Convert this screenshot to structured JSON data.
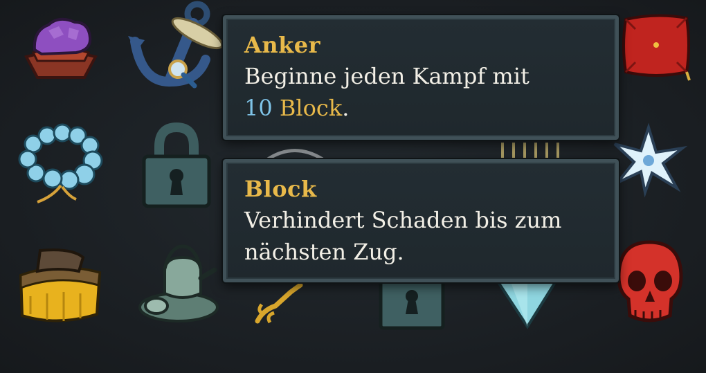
{
  "relics": [
    {
      "name": "Pandora-Box",
      "icon": "purple-crystal-on-pedestal-icon"
    },
    {
      "name": "Anchor",
      "icon": "anchor-icon"
    },
    {
      "name": "Red Pillow",
      "icon": "red-pillow-icon"
    },
    {
      "name": "Juzu Bracelet",
      "icon": "blue-bead-bracelet-icon"
    },
    {
      "name": "Locked Relic",
      "icon": "padlock-icon"
    },
    {
      "name": "Snowflake",
      "icon": "snowflake-icon"
    },
    {
      "name": "Golden Belt",
      "icon": "gold-belt-icon"
    },
    {
      "name": "Teapot",
      "icon": "teapot-icon"
    },
    {
      "name": "Vajra",
      "icon": "vajra-icon"
    },
    {
      "name": "Locked Relic",
      "icon": "keyhole-lock-icon"
    },
    {
      "name": "Crystal",
      "icon": "blue-crystal-icon"
    },
    {
      "name": "Red Skull",
      "icon": "red-skull-icon"
    }
  ],
  "tooltips": {
    "anchor": {
      "title": "Anker",
      "body_line1": "Beginne jeden Kampf mit",
      "body_number": "10",
      "body_keyword": "Block",
      "body_end": "."
    },
    "block": {
      "title": "Block",
      "body_line1": "Verhindert Schaden bis zum",
      "body_line2": "nächsten Zug."
    }
  },
  "colors": {
    "title_gold": "#e8b94a",
    "number_blue": "#7fc4e8",
    "body_text": "#f2efe6",
    "panel_border": "#405158"
  }
}
